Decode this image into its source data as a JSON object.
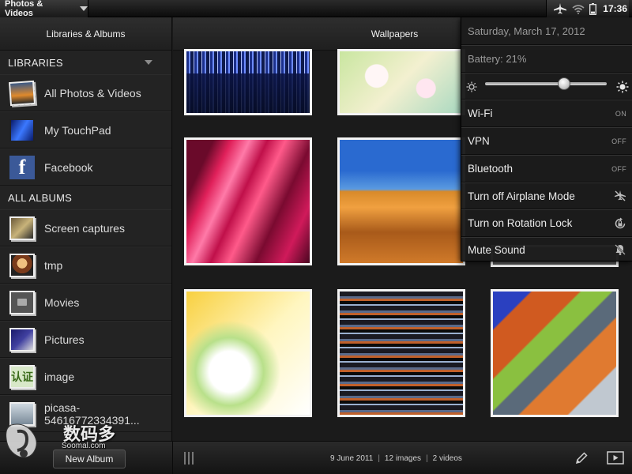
{
  "status_bar": {
    "app_name": "Photos & Videos",
    "clock": "17:36",
    "icons": [
      "airplane-icon",
      "wifi-icon",
      "battery-icon"
    ]
  },
  "sidebar": {
    "header": "Libraries & Albums",
    "libraries_label": "LIBRARIES",
    "libraries": [
      {
        "label": "All Photos & Videos",
        "icon": "photos-thumbnail"
      },
      {
        "label": "My TouchPad",
        "icon": "touchpad-thumbnail"
      },
      {
        "label": "Facebook",
        "icon": "facebook-icon",
        "glyph": "f"
      }
    ],
    "albums_label": "ALL ALBUMS",
    "albums": [
      {
        "label": "Screen captures"
      },
      {
        "label": "tmp"
      },
      {
        "label": "Movies"
      },
      {
        "label": "Pictures"
      },
      {
        "label": "image",
        "glyph": "认证"
      },
      {
        "label": "picasa-54616772334391..."
      }
    ]
  },
  "main": {
    "header": "Wallpapers"
  },
  "bottom_bar": {
    "new_album": "New Album",
    "date": "9 June 2011",
    "images": "12 images",
    "videos": "2 videos",
    "separator": "|"
  },
  "watermark": {
    "text": "数码多",
    "sub": "Soomal.com"
  },
  "quick_menu": {
    "date": "Saturday, March 17, 2012",
    "battery": "Battery: 21%",
    "brightness": 0.65,
    "wifi": {
      "label": "Wi-Fi",
      "state": "ON"
    },
    "vpn": {
      "label": "VPN",
      "state": "OFF"
    },
    "bluetooth": {
      "label": "Bluetooth",
      "state": "OFF"
    },
    "airplane": {
      "label": "Turn off Airplane Mode",
      "icon": "airplane-off-icon"
    },
    "rotation": {
      "label": "Turn on Rotation Lock",
      "icon": "rotation-lock-icon"
    },
    "mute": {
      "label": "Mute Sound",
      "icon": "mute-icon"
    }
  }
}
